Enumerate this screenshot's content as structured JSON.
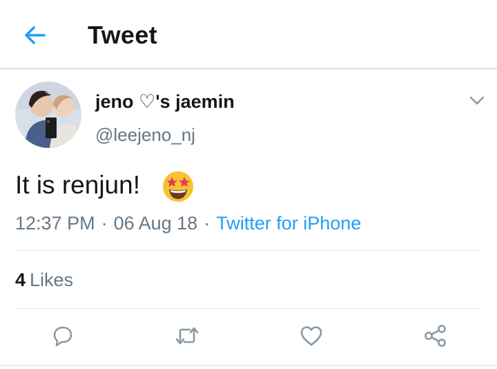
{
  "header": {
    "title": "Tweet",
    "back_icon": "arrow-left-icon"
  },
  "tweet": {
    "author": {
      "display_name": "jeno ♡'s jaemin",
      "handle": "@leejeno_nj"
    },
    "text": "It is renjun!",
    "emoji": "star-struck-emoji",
    "time": "12:37 PM",
    "date": "06 Aug 18",
    "separator": "·",
    "source": "Twitter for iPhone",
    "likes": {
      "count": "4",
      "label": "Likes"
    }
  },
  "actions": [
    "reply-icon",
    "retweet-icon",
    "like-icon",
    "share-icon"
  ],
  "colors": {
    "accent": "#1da1f2",
    "muted": "#657786",
    "text": "#14171a",
    "divider": "#e1e8ed",
    "icon": "#8899a6"
  }
}
